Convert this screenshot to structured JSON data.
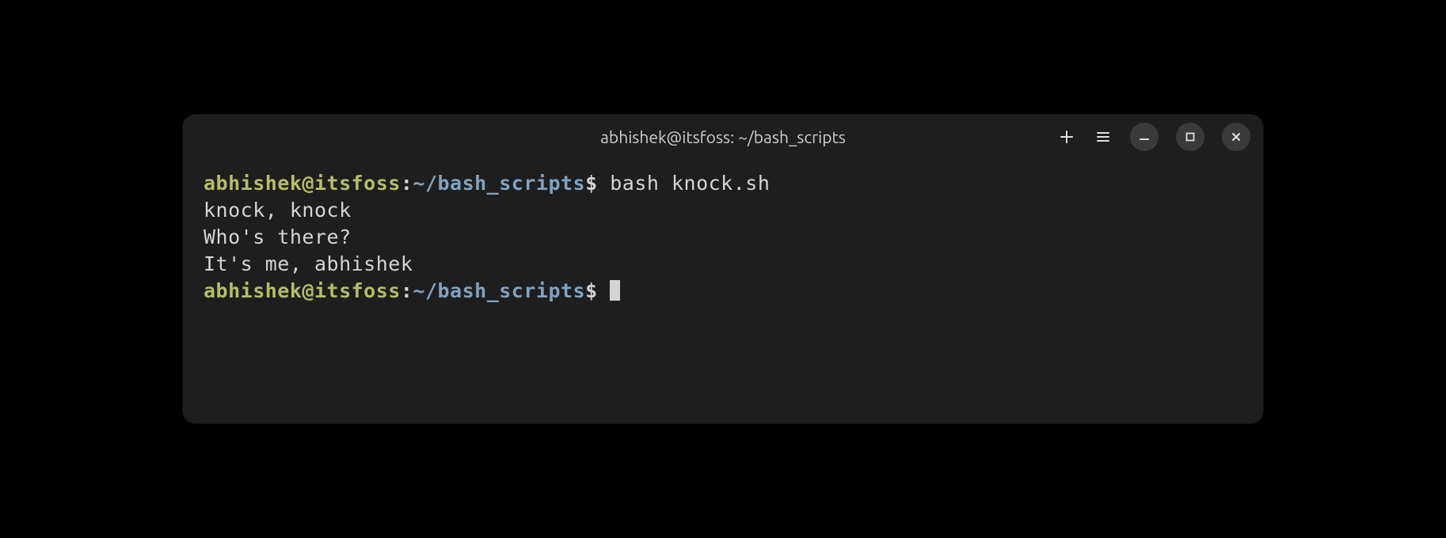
{
  "window": {
    "title": "abhishek@itsfoss: ~/bash_scripts"
  },
  "prompt": {
    "user_host": "abhishek@itsfoss",
    "colon": ":",
    "path": "~/bash_scripts",
    "dollar": "$"
  },
  "lines": {
    "command1": " bash knock.sh",
    "output1": "knock, knock",
    "output2": "Who's there?",
    "output3": "It's me, abhishek",
    "command2_input": " "
  }
}
